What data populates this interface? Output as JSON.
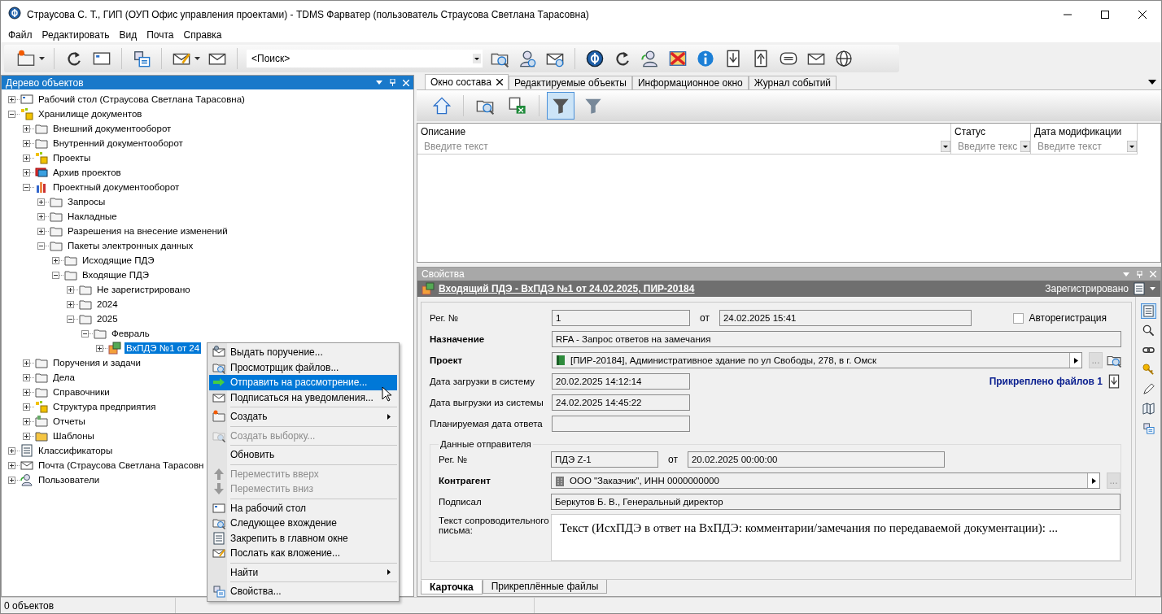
{
  "window": {
    "title": "Страусова С. Т., ГИП (ОУП Офис управления проектами) - TDMS Фарватер (пользователь Страусова Светлана Тарасовна)"
  },
  "menu": [
    "Файл",
    "Редактировать",
    "Вид",
    "Почта",
    "Справка"
  ],
  "search": {
    "value": "<Поиск>"
  },
  "tree": {
    "title": "Дерево объектов",
    "items": [
      {
        "label": "Рабочий стол (Страусова Светлана Тарасовна)",
        "kind": "desktop",
        "expanded": false,
        "selected": false
      },
      {
        "label": "Хранилище документов",
        "kind": "storage",
        "expanded": true,
        "selected": false,
        "children": [
          {
            "label": "Внешний документооборот",
            "kind": "folder",
            "expanded": false,
            "selected": false
          },
          {
            "label": "Внутренний документооборот",
            "kind": "folder",
            "expanded": false,
            "selected": false
          },
          {
            "label": "Проекты",
            "kind": "storage",
            "expanded": false,
            "selected": false
          },
          {
            "label": "Архив проектов",
            "kind": "archive",
            "expanded": false,
            "selected": false
          },
          {
            "label": "Проектный документооборот",
            "kind": "chart",
            "expanded": true,
            "selected": false,
            "children": [
              {
                "label": "Запросы",
                "kind": "folder",
                "expanded": false,
                "selected": false
              },
              {
                "label": "Накладные",
                "kind": "folder",
                "expanded": false,
                "selected": false
              },
              {
                "label": "Разрешения на внесение изменений",
                "kind": "folder",
                "expanded": false,
                "selected": false
              },
              {
                "label": "Пакеты электронных данных",
                "kind": "folder",
                "expanded": true,
                "selected": false,
                "children": [
                  {
                    "label": "Исходящие ПДЭ",
                    "kind": "folder",
                    "expanded": false,
                    "selected": false
                  },
                  {
                    "label": "Входящие ПДЭ",
                    "kind": "folder",
                    "expanded": true,
                    "selected": false,
                    "children": [
                      {
                        "label": "Не зарегистрировано",
                        "kind": "folder",
                        "expanded": false,
                        "selected": false
                      },
                      {
                        "label": "2024",
                        "kind": "folder",
                        "expanded": false,
                        "selected": false
                      },
                      {
                        "label": "2025",
                        "kind": "folder",
                        "expanded": true,
                        "selected": false,
                        "children": [
                          {
                            "label": "Февраль",
                            "kind": "folder",
                            "expanded": true,
                            "selected": false,
                            "children": [
                              {
                                "label": "ВхПДЭ №1 от 24",
                                "kind": "package",
                                "expanded": false,
                                "selected": true
                              }
                            ]
                          }
                        ]
                      }
                    ]
                  }
                ]
              }
            ]
          },
          {
            "label": "Поручения и задачи",
            "kind": "folder",
            "expanded": false,
            "selected": false
          },
          {
            "label": "Дела",
            "kind": "folder",
            "expanded": false,
            "selected": false
          },
          {
            "label": "Справочники",
            "kind": "folder",
            "expanded": false,
            "selected": false
          },
          {
            "label": "Структура предприятия",
            "kind": "structure",
            "expanded": false,
            "selected": false
          },
          {
            "label": "Отчеты",
            "kind": "report",
            "expanded": false,
            "selected": false
          },
          {
            "label": "Шаблоны",
            "kind": "template",
            "expanded": false,
            "selected": false
          }
        ]
      },
      {
        "label": "Классификаторы",
        "kind": "classifier",
        "expanded": false,
        "selected": false
      },
      {
        "label": "Почта (Страусова Светлана Тарасовн",
        "kind": "mail",
        "expanded": false,
        "selected": false
      },
      {
        "label": "Пользователи",
        "kind": "users",
        "expanded": false,
        "selected": false
      }
    ]
  },
  "context_menu": [
    {
      "kind": "item",
      "label": "Выдать поручение...",
      "disabled": false,
      "selected": false,
      "submenu": false
    },
    {
      "kind": "item",
      "label": "Просмотрщик файлов...",
      "disabled": false,
      "selected": false,
      "submenu": false
    },
    {
      "kind": "item",
      "label": "Отправить на рассмотрение...",
      "disabled": false,
      "selected": true,
      "submenu": false
    },
    {
      "kind": "item",
      "label": "Подписаться на уведомления...",
      "disabled": false,
      "selected": false,
      "submenu": false
    },
    {
      "kind": "separator"
    },
    {
      "kind": "item",
      "label": "Создать",
      "disabled": false,
      "selected": false,
      "submenu": true
    },
    {
      "kind": "separator"
    },
    {
      "kind": "item",
      "label": "Создать выборку...",
      "disabled": true,
      "selected": false,
      "submenu": false
    },
    {
      "kind": "separator"
    },
    {
      "kind": "item",
      "label": "Обновить",
      "disabled": false,
      "selected": false,
      "submenu": false
    },
    {
      "kind": "separator"
    },
    {
      "kind": "item",
      "label": "Переместить вверх",
      "disabled": true,
      "selected": false,
      "submenu": false
    },
    {
      "kind": "item",
      "label": "Переместить вниз",
      "disabled": true,
      "selected": false,
      "submenu": false
    },
    {
      "kind": "separator"
    },
    {
      "kind": "item",
      "label": "На рабочий стол",
      "disabled": false,
      "selected": false,
      "submenu": false
    },
    {
      "kind": "item",
      "label": "Следующее вхождение",
      "disabled": false,
      "selected": false,
      "submenu": false
    },
    {
      "kind": "item",
      "label": "Закрепить в главном окне",
      "disabled": false,
      "selected": false,
      "submenu": false
    },
    {
      "kind": "item",
      "label": "Послать как вложение...",
      "disabled": false,
      "selected": false,
      "submenu": false
    },
    {
      "kind": "separator"
    },
    {
      "kind": "item",
      "label": "Найти",
      "disabled": false,
      "selected": false,
      "submenu": true
    },
    {
      "kind": "separator"
    },
    {
      "kind": "item",
      "label": "Свойства...",
      "disabled": false,
      "selected": false,
      "submenu": false
    }
  ],
  "tabs": [
    {
      "label": "Окно состава",
      "selected": true,
      "closable": true
    },
    {
      "label": "Редактируемые объекты",
      "selected": false,
      "closable": false
    },
    {
      "label": "Информационное окно",
      "selected": false,
      "closable": false
    },
    {
      "label": "Журнал событий",
      "selected": false,
      "closable": false
    }
  ],
  "table": {
    "columns": [
      {
        "label": "Описание",
        "placeholder": "Введите текст"
      },
      {
        "label": "Статус",
        "placeholder": "Введите текс"
      },
      {
        "label": "Дата модификации",
        "placeholder": "Введите текст"
      }
    ]
  },
  "properties": {
    "header": "Свойства",
    "object_title": "Входящий ПДЭ - ВхПДЭ №1 от 24.02.2025, ПИР-20184",
    "status": "Зарегистрировано",
    "reg_no": {
      "label": "Рег. №",
      "value": "1",
      "date_label": "от",
      "date": "24.02.2025 15:41"
    },
    "auto_registration": {
      "label": "Авторегистрация",
      "checked": false
    },
    "purpose": {
      "label": "Назначение",
      "value": "RFA - Запрос ответов на замечания",
      "required": true
    },
    "project": {
      "label": "Проект",
      "value": "[ПИР-20184], Административное здание по ул Свободы, 278, в г. Омск",
      "required": true,
      "dots": "..."
    },
    "attached": "Прикреплено файлов 1",
    "dates": [
      {
        "label": "Дата загрузки в систему",
        "value": "20.02.2025 14:12:14"
      },
      {
        "label": "Дата выгрузки из системы",
        "value": "24.02.2025 14:45:22"
      },
      {
        "label": "Планируемая дата ответа"
      }
    ],
    "sender": {
      "title": "Данные отправителя",
      "reg_no": {
        "label": "Рег. №",
        "value": "ПДЭ Z-1",
        "date_label": "от",
        "date": "20.02.2025 00:00:00"
      },
      "counterparty": {
        "label": "Контрагент",
        "value": "ООО \"Заказчик\", ИНН 0000000000",
        "required": true,
        "dots": "..."
      },
      "signed_by": {
        "label": "Подписал",
        "value": "Беркутов Б. В., Генеральный директор"
      },
      "cover_letter": {
        "label": "Текст сопроводительного письма:",
        "value": "Текст (ИсхПДЭ в ответ на ВхПДЭ: комментарии/замечания по передаваемой документации): ..."
      }
    },
    "tabs": [
      {
        "label": "Карточка",
        "selected": true
      },
      {
        "label": "Прикреплённые файлы",
        "selected": false
      }
    ]
  },
  "status_bar": {
    "text": "0 объектов"
  }
}
